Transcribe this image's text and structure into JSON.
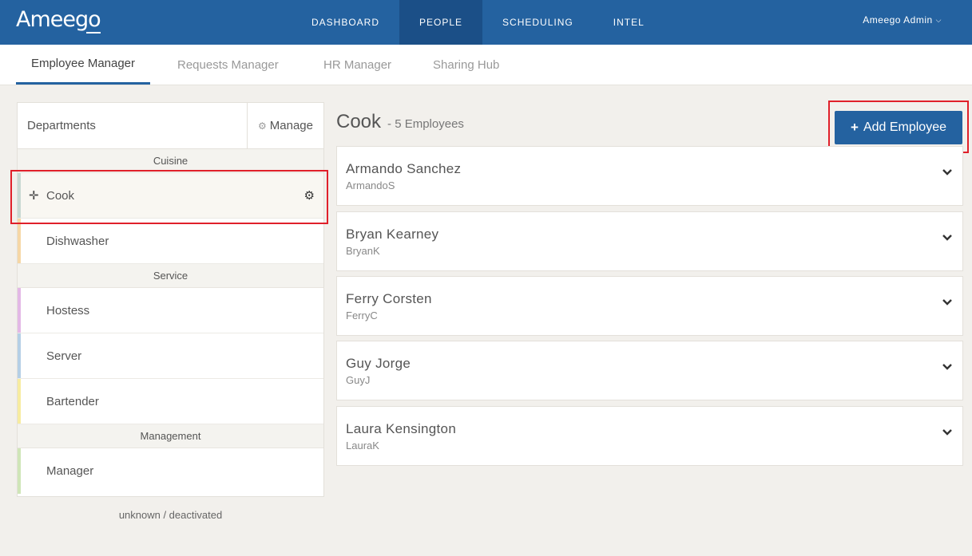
{
  "app": {
    "logo": "Ameego"
  },
  "nav": {
    "items": [
      {
        "label": "DASHBOARD",
        "active": false
      },
      {
        "label": "PEOPLE",
        "active": true
      },
      {
        "label": "SCHEDULING",
        "active": false
      },
      {
        "label": "INTEL",
        "active": false
      }
    ],
    "user": "Ameego Admin"
  },
  "subtabs": [
    {
      "label": "Employee Manager",
      "active": true
    },
    {
      "label": "Requests Manager",
      "active": false
    },
    {
      "label": "HR Manager",
      "active": false
    },
    {
      "label": "Sharing Hub",
      "active": false
    }
  ],
  "departments": {
    "title": "Departments",
    "manage_label": "Manage",
    "groups": [
      {
        "name": "Cuisine",
        "items": [
          {
            "label": "Cook",
            "color": "#c8d9d2",
            "selected": true
          },
          {
            "label": "Dishwasher",
            "color": "#f6d7a6"
          }
        ]
      },
      {
        "name": "Service",
        "items": [
          {
            "label": "Hostess",
            "color": "#e3b8e6"
          },
          {
            "label": "Server",
            "color": "#b5cfe6"
          },
          {
            "label": "Bartender",
            "color": "#f7eca0"
          }
        ]
      },
      {
        "name": "Management",
        "items": [
          {
            "label": "Manager",
            "color": "#cfe6b8"
          }
        ]
      }
    ],
    "footer": "unknown / deactivated"
  },
  "main": {
    "department": "Cook",
    "count_label": "- 5 Employees",
    "add_button": "Add Employee",
    "employees": [
      {
        "name": "Armando Sanchez",
        "username": "ArmandoS"
      },
      {
        "name": "Bryan Kearney",
        "username": "BryanK"
      },
      {
        "name": "Ferry Corsten",
        "username": "FerryC"
      },
      {
        "name": "Guy Jorge",
        "username": "GuyJ"
      },
      {
        "name": "Laura Kensington",
        "username": "LauraK"
      }
    ]
  },
  "colors": {
    "brand": "#2462a0",
    "nav_active": "#1b4f87",
    "highlight": "#e0202a"
  }
}
